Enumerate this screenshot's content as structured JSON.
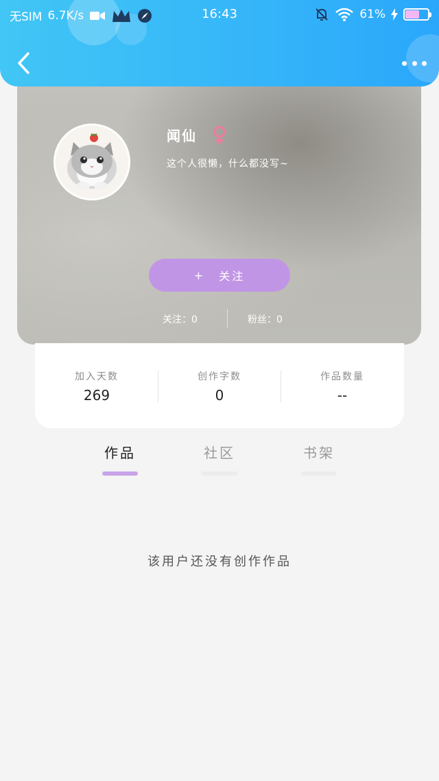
{
  "status_bar": {
    "carrier": "无SIM",
    "network_speed": "6.7K/s",
    "time": "16:43",
    "battery_percent": "61%",
    "battery_level": 0.61,
    "battery_color": "#f5b8f4",
    "icons": [
      "video-icon",
      "crown-icon",
      "compass-icon",
      "mute-bell-icon",
      "wifi-icon",
      "charging-icon"
    ]
  },
  "nav": {
    "back_icon": "chevron-left-icon",
    "more_icon": "more-dots-icon",
    "gradient_colors": [
      "#41c6f5",
      "#2aa7fb"
    ]
  },
  "profile": {
    "name": "闻仙",
    "gender_icon": "female-icon",
    "gender_color": "#f07aa0",
    "bio": "这个人很懒，什么都没写~",
    "follow_button_plus": "+",
    "follow_button_label": "关注",
    "follow_button_color": "#c195e6",
    "following_text": "关注：0",
    "fans_text": "粉丝：0"
  },
  "stats": [
    {
      "label": "加入天数",
      "value": "269"
    },
    {
      "label": "创作字数",
      "value": "0"
    },
    {
      "label": "作品数量",
      "value": "--"
    }
  ],
  "tabs": [
    {
      "label": "作品",
      "active": true
    },
    {
      "label": "社区",
      "active": false
    },
    {
      "label": "书架",
      "active": false
    }
  ],
  "tab_accent": "#c8a3ea",
  "empty_message": "该用户还没有创作作品"
}
